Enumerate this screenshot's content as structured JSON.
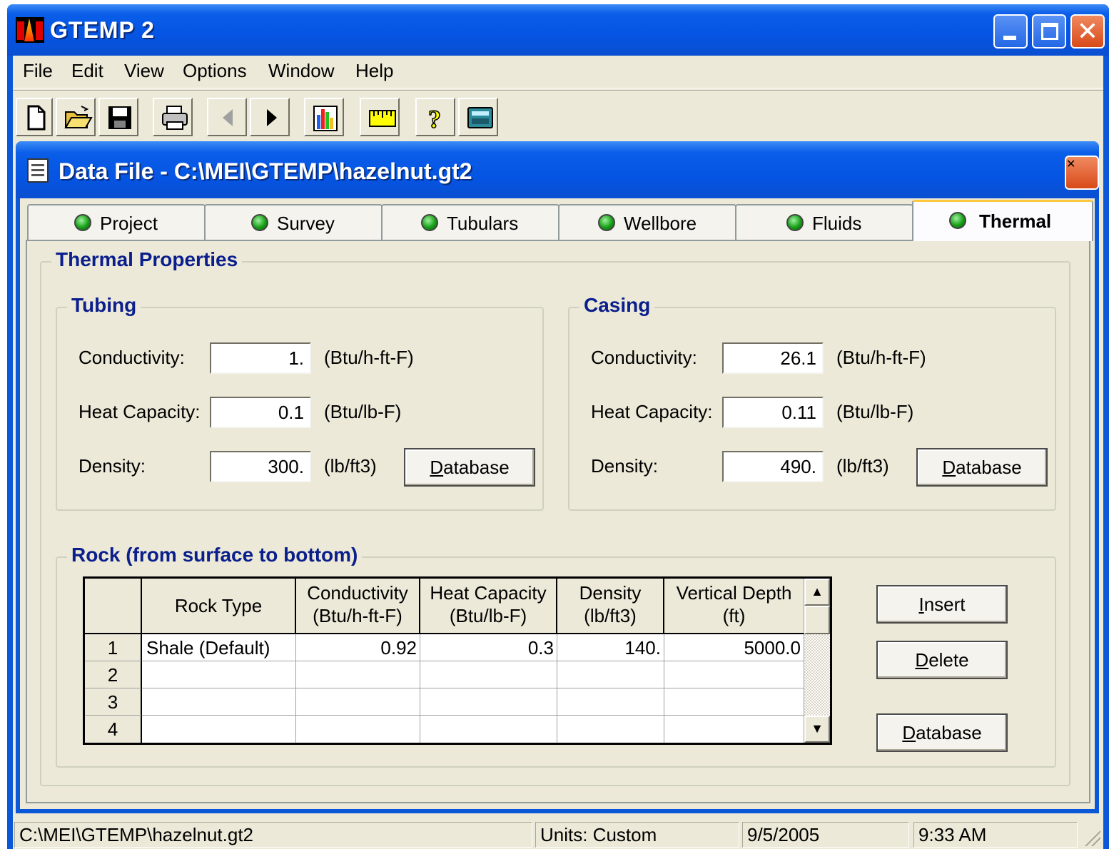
{
  "app": {
    "title": "GTEMP 2"
  },
  "menu": [
    "File",
    "Edit",
    "View",
    "Options",
    "Window",
    "Help"
  ],
  "child": {
    "title": "Data File - C:\\MEI\\GTEMP\\hazelnut.gt2"
  },
  "tabs": [
    "Project",
    "Survey",
    "Tubulars",
    "Wellbore",
    "Fluids",
    "Thermal"
  ],
  "active_tab": "Thermal",
  "thermal": {
    "title": "Thermal Properties",
    "tubing": {
      "title": "Tubing",
      "conductivity_label": "Conductivity:",
      "conductivity": "1.",
      "conductivity_unit": "(Btu/h-ft-F)",
      "heat_label": "Heat Capacity:",
      "heat": "0.1",
      "heat_unit": "(Btu/lb-F)",
      "density_label": "Density:",
      "density": "300.",
      "density_unit": "(lb/ft3)",
      "db_pre": "",
      "db_key": "D",
      "db_post": "atabase"
    },
    "casing": {
      "title": "Casing",
      "conductivity_label": "Conductivity:",
      "conductivity": "26.1",
      "conductivity_unit": "(Btu/h-ft-F)",
      "heat_label": "Heat Capacity:",
      "heat": "0.11",
      "heat_unit": "(Btu/lb-F)",
      "density_label": "Density:",
      "density": "490.",
      "density_unit": "(lb/ft3)",
      "db_pre": "",
      "db_key": "D",
      "db_post": "atabase"
    },
    "rock": {
      "title": "Rock (from surface to bottom)",
      "headers": {
        "type": "Rock Type",
        "cond1": "Conductivity",
        "cond2": "(Btu/h-ft-F)",
        "heat1": "Heat Capacity",
        "heat2": "(Btu/lb-F)",
        "dens1": "Density",
        "dens2": "(lb/ft3)",
        "depth1": "Vertical Depth",
        "depth2": "(ft)"
      },
      "rows": [
        {
          "n": "1",
          "type": "Shale (Default)",
          "cond": "0.92",
          "heat": "0.3",
          "dens": "140.",
          "depth": "5000.0"
        },
        {
          "n": "2",
          "type": "",
          "cond": "",
          "heat": "",
          "dens": "",
          "depth": ""
        },
        {
          "n": "3",
          "type": "",
          "cond": "",
          "heat": "",
          "dens": "",
          "depth": ""
        },
        {
          "n": "4",
          "type": "",
          "cond": "",
          "heat": "",
          "dens": "",
          "depth": ""
        }
      ],
      "buttons": {
        "insert_key": "I",
        "insert_post": "nsert",
        "delete_key": "D",
        "delete_post": "elete",
        "database_key": "D",
        "database_post": "atabase"
      }
    }
  },
  "status": {
    "path": "C:\\MEI\\GTEMP\\hazelnut.gt2",
    "units": "Units: Custom",
    "date": "9/5/2005",
    "time": "9:33 AM"
  },
  "icons": [
    "new-file-icon",
    "open-folder-icon",
    "save-icon",
    "print-icon",
    "back-arrow-icon",
    "forward-arrow-icon",
    "chart-icon",
    "ruler-icon",
    "help-icon",
    "calculator-icon"
  ],
  "colors": {
    "title_bar": "#0554e3",
    "group_title": "#0a1e8c",
    "face": "#ece9d8",
    "tab_highlight": "#ffc83c",
    "led_green": "#18a018"
  }
}
